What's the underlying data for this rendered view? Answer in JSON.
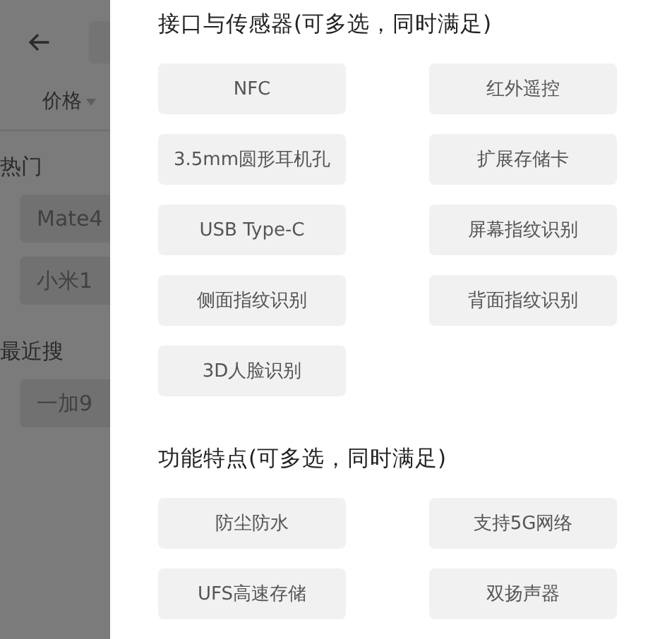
{
  "background_page": {
    "filter_label": "价格",
    "hot": {
      "title": "热门",
      "items": [
        "Mate4",
        "小米1"
      ]
    },
    "recent": {
      "title": "最近搜",
      "items": [
        "一加9"
      ]
    }
  },
  "filter_panel": {
    "sections": [
      {
        "title": "接口与传感器(可多选，同时满足)",
        "options": [
          {
            "label": "NFC",
            "selected": false
          },
          {
            "label": "红外遥控",
            "selected": false
          },
          {
            "label": "3.5mm圆形耳机孔",
            "selected": false
          },
          {
            "label": "扩展存储卡",
            "selected": false
          },
          {
            "label": "USB Type-C",
            "selected": false
          },
          {
            "label": "屏幕指纹识别",
            "selected": false
          },
          {
            "label": "侧面指纹识别",
            "selected": false
          },
          {
            "label": "背面指纹识别",
            "selected": false
          },
          {
            "label": "3D人脸识别",
            "selected": false
          }
        ]
      },
      {
        "title": "功能特点(可多选，同时满足)",
        "options": [
          {
            "label": "防尘防水",
            "selected": false
          },
          {
            "label": "支持5G网络",
            "selected": false
          },
          {
            "label": "UFS高速存储",
            "selected": false
          },
          {
            "label": "双扬声器",
            "selected": false
          }
        ]
      }
    ]
  }
}
